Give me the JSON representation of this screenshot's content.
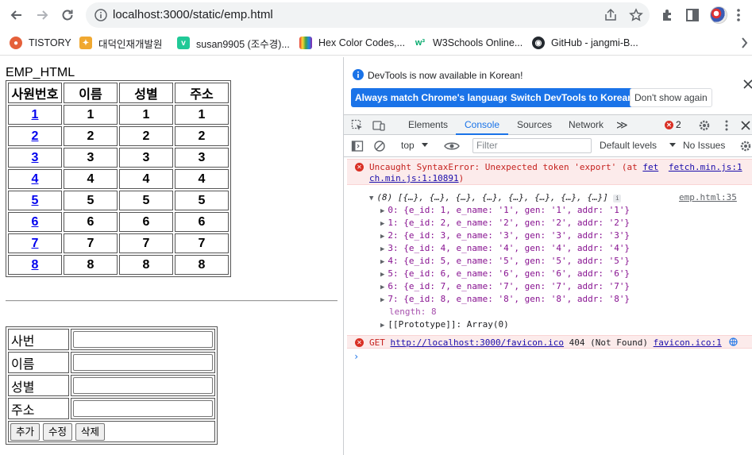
{
  "browser": {
    "url": "localhost:3000/static/emp.html",
    "bookmarks": [
      {
        "label": "TISTORY",
        "color": "#e5603a"
      },
      {
        "label": "대덕인재개발원",
        "color": "#f0a830"
      },
      {
        "label": "susan9905 (조수경)...",
        "color": "#20c997"
      },
      {
        "label": "Hex Color Codes,...",
        "color": "#5c6bc0"
      },
      {
        "label": "W3Schools Online...",
        "color": "#04aa6d"
      },
      {
        "label": "GitHub - jangmi-B...",
        "color": "#24292f"
      }
    ]
  },
  "page": {
    "title": "EMP_HTML",
    "table": {
      "headers": [
        "사원번호",
        "이름",
        "성별",
        "주소"
      ],
      "rows": [
        [
          "1",
          "1",
          "1",
          "1"
        ],
        [
          "2",
          "2",
          "2",
          "2"
        ],
        [
          "3",
          "3",
          "3",
          "3"
        ],
        [
          "4",
          "4",
          "4",
          "4"
        ],
        [
          "5",
          "5",
          "5",
          "5"
        ],
        [
          "6",
          "6",
          "6",
          "6"
        ],
        [
          "7",
          "7",
          "7",
          "7"
        ],
        [
          "8",
          "8",
          "8",
          "8"
        ]
      ]
    },
    "form": {
      "fields": [
        {
          "label": "사번",
          "value": ""
        },
        {
          "label": "이름",
          "value": ""
        },
        {
          "label": "성별",
          "value": ""
        },
        {
          "label": "주소",
          "value": ""
        }
      ],
      "buttons": [
        "추가",
        "수정",
        "삭제"
      ]
    }
  },
  "devtools": {
    "banner_message": "DevTools is now available in Korean!",
    "banner_buttons": {
      "match": "Always match Chrome's language",
      "switch": "Switch DevTools to Korean",
      "dismiss": "Don't show again"
    },
    "tabs": [
      "Elements",
      "Console",
      "Sources",
      "Network"
    ],
    "active_tab": "Console",
    "more_tabs": "≫",
    "error_count": "2",
    "context": "top",
    "filter_placeholder": "Filter",
    "levels": "Default levels",
    "issues": "No Issues",
    "console": {
      "error1": {
        "text": "Uncaught SyntaxError: Unexpected token 'export' (at ",
        "link1": "fet",
        "link2": "fetch.min.js:1",
        "line2": "ch.min.js:1:10891",
        "suffix": ")"
      },
      "array_summary": "(8) [{…}, {…}, {…}, {…}, {…}, {…}, {…}, {…}]",
      "array_source": "emp.html:35",
      "items": [
        "0: {e_id: 1, e_name: '1', gen: '1', addr: '1'}",
        "1: {e_id: 2, e_name: '2', gen: '2', addr: '2'}",
        "2: {e_id: 3, e_name: '3', gen: '3', addr: '3'}",
        "3: {e_id: 4, e_name: '4', gen: '4', addr: '4'}",
        "4: {e_id: 5, e_name: '5', gen: '5', addr: '5'}",
        "5: {e_id: 6, e_name: '6', gen: '6', addr: '6'}",
        "6: {e_id: 7, e_name: '7', gen: '7', addr: '7'}",
        "7: {e_id: 8, e_name: '8', gen: '8', addr: '8'}"
      ],
      "length_line": "length: 8",
      "prototype_line": "[[Prototype]]: Array(0)",
      "error2": {
        "method": "GET",
        "url": "http://localhost:3000/favicon.ico",
        "status": "404 (Not Found)",
        "source": "favicon.ico:1"
      }
    }
  }
}
